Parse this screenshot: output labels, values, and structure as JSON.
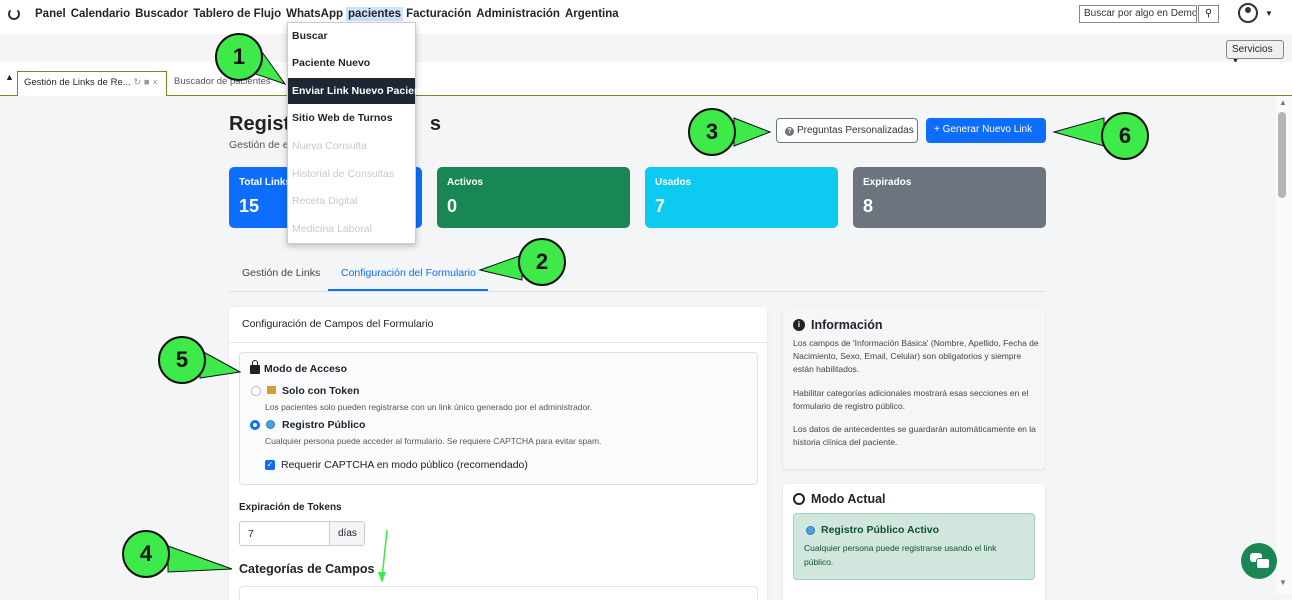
{
  "navbar": {
    "items": [
      "Panel",
      "Calendario",
      "Buscador",
      "Tablero de Flujo",
      "WhatsApp",
      "pacientes",
      "Facturación",
      "Administración",
      "Argentina"
    ],
    "active_index": 5,
    "search_placeholder": "Buscar por algo en Demografía",
    "servicios_label": "Servicios",
    "user_icon": "user-circle-icon"
  },
  "tabs": {
    "tab1_label": "Gestión de Links de Re...",
    "tab2_label": "Buscador de pacientes"
  },
  "dropdown": {
    "items": [
      {
        "label": "Buscar",
        "state": "normal"
      },
      {
        "label": "Paciente Nuevo",
        "state": "normal"
      },
      {
        "label": "Enviar Link Nuevo Paciente",
        "state": "highlighted"
      },
      {
        "label": "Sitio Web de Turnos",
        "state": "normal"
      },
      {
        "label": "Nueva Consulta",
        "state": "disabled"
      },
      {
        "label": "Historial de Consultas",
        "state": "disabled"
      },
      {
        "label": "Receta Digital",
        "state": "disabled"
      },
      {
        "label": "Medicina Laboral",
        "state": "disabled"
      }
    ]
  },
  "page": {
    "title_visible": "Registr",
    "title_tail": "s",
    "subtitle_visible": "Gestión de en",
    "btn_preguntas": "Preguntas Personalizadas",
    "btn_generar": "+ Generar Nuevo Link"
  },
  "stats": [
    {
      "label": "Total Links",
      "value": "15",
      "color": "#0d6efd"
    },
    {
      "label": "Activos",
      "value": "0",
      "color": "#198754"
    },
    {
      "label": "Usados",
      "value": "7",
      "color": "#0dcaf0"
    },
    {
      "label": "Expirados",
      "value": "8",
      "color": "#6c757d"
    }
  ],
  "subtabs": {
    "tab1": "Gestión de Links",
    "tab2": "Configuración del Formulario"
  },
  "form": {
    "card_title": "Configuración de Campos del Formulario",
    "access_title": "Modo de Acceso",
    "opt1_title": "Solo con Token",
    "opt1_desc": "Los pacientes solo pueden registrarse con un link único generado por el administrador.",
    "opt2_title": "Registro Público",
    "opt2_desc": "Cualquier persona puede acceder al formulario. Se requiere CAPTCHA para evitar spam.",
    "captcha_label": "Requerir CAPTCHA en modo público (recomendado)",
    "exp_title": "Expiración de Tokens",
    "exp_value": "7",
    "exp_unit": "días",
    "cat_title": "Categorías de Campos"
  },
  "info": {
    "title": "Información",
    "p1": "Los campos de 'Información Básica' (Nombre, Apellido, Fecha de Nacimiento, Sexo, Email, Celular) son obligatorios y siempre están habilitados.",
    "p2": "Habilitar categorías adicionales mostrará esas secciones en el formulario de registro público.",
    "p3": "Los datos de antecedentes se guardarán automáticamente en la historia clínica del paciente."
  },
  "mode": {
    "title": "Modo Actual",
    "box_title": "Registro Público Activo",
    "box_desc": "Cualquier persona puede registrarse usando el link público."
  },
  "callouts": [
    "1",
    "2",
    "3",
    "4",
    "5",
    "6"
  ],
  "annotation_color": "#3ee94a"
}
